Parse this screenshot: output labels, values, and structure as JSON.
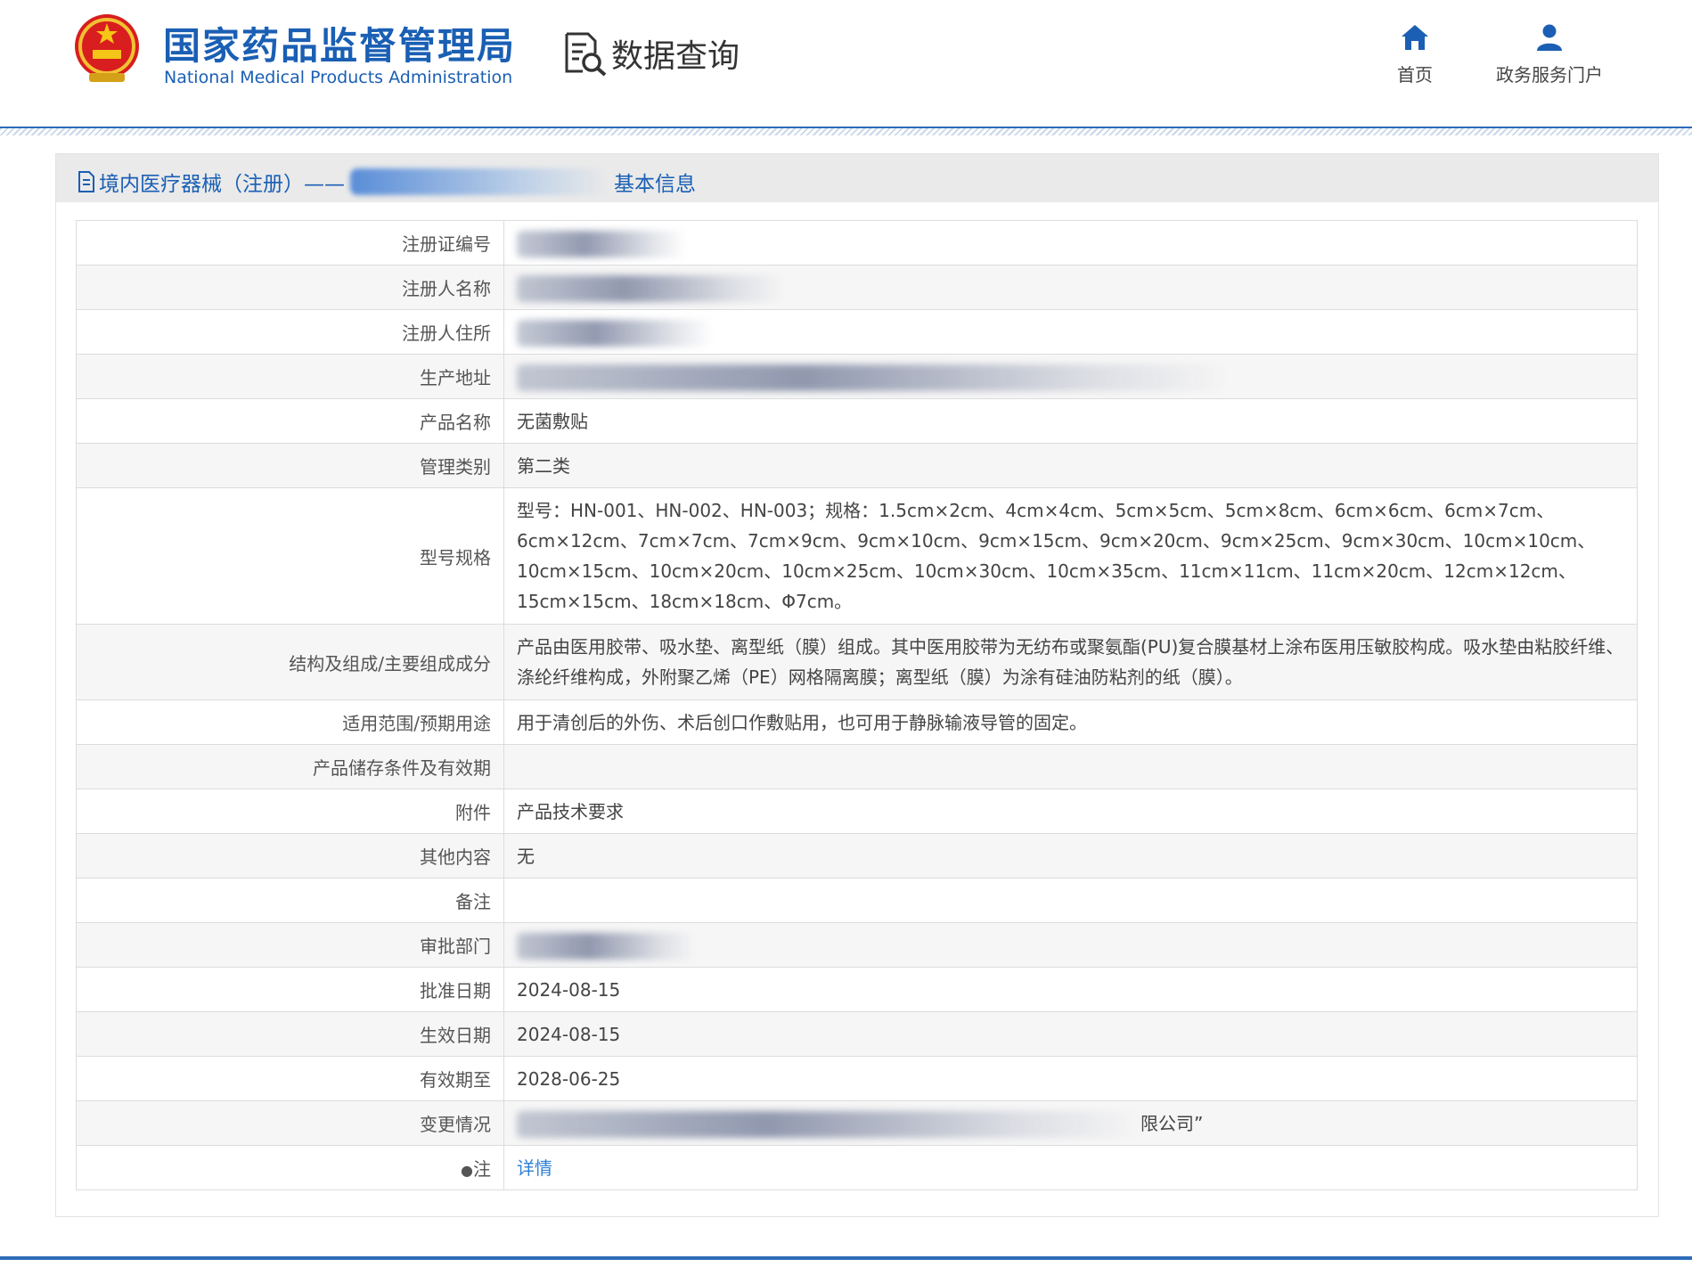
{
  "header": {
    "logo_cn": "国家药品监督管理局",
    "logo_en": "National Medical Products Administration",
    "query_title": "数据查询",
    "nav": [
      {
        "label": "首页",
        "icon": "home-icon"
      },
      {
        "label": "政务服务门户",
        "icon": "user-icon"
      }
    ]
  },
  "panel": {
    "title_prefix": "境内医疗器械（注册）——",
    "title_suffix": "基本信息"
  },
  "rows": [
    {
      "label": "注册证编号",
      "value": "",
      "redacted": true
    },
    {
      "label": "注册人名称",
      "value": "",
      "redacted": true
    },
    {
      "label": "注册人住所",
      "value": "",
      "redacted": true
    },
    {
      "label": "生产地址",
      "value": "",
      "redacted": true
    },
    {
      "label": "产品名称",
      "value": "无菌敷贴"
    },
    {
      "label": "管理类别",
      "value": "第二类"
    },
    {
      "label": "型号规格",
      "value": "型号：HN-001、HN-002、HN-003；规格：1.5cm×2cm、4cm×4cm、5cm×5cm、5cm×8cm、6cm×6cm、6cm×7cm、6cm×12cm、7cm×7cm、7cm×9cm、9cm×10cm、9cm×15cm、9cm×20cm、9cm×25cm、9cm×30cm、10cm×10cm、10cm×15cm、10cm×20cm、10cm×25cm、10cm×30cm、10cm×35cm、11cm×11cm、11cm×20cm、12cm×12cm、15cm×15cm、18cm×18cm、Φ7cm。"
    },
    {
      "label": "结构及组成/主要组成成分",
      "value": "产品由医用胶带、吸水垫、离型纸（膜）组成。其中医用胶带为无纺布或聚氨酯(PU)复合膜基材上涂布医用压敏胶构成。吸水垫由粘胶纤维、涤纶纤维构成，外附聚乙烯（PE）网格隔离膜；离型纸（膜）为涂有硅油防粘剂的纸（膜）。"
    },
    {
      "label": "适用范围/预期用途",
      "value": "用于清创后的外伤、术后创口作敷贴用，也可用于静脉输液导管的固定。"
    },
    {
      "label": "产品储存条件及有效期",
      "value": ""
    },
    {
      "label": "附件",
      "value": "产品技术要求"
    },
    {
      "label": "其他内容",
      "value": "无"
    },
    {
      "label": "备注",
      "value": ""
    },
    {
      "label": "审批部门",
      "value": "",
      "redacted": true
    },
    {
      "label": "批准日期",
      "value": "2024-08-15"
    },
    {
      "label": "生效日期",
      "value": "2024-08-15"
    },
    {
      "label": "有效期至",
      "value": "2028-06-25"
    },
    {
      "label": "变更情况",
      "value": "限公司”",
      "redacted": true
    },
    {
      "label": "注",
      "value": "详情",
      "link": true
    }
  ]
}
